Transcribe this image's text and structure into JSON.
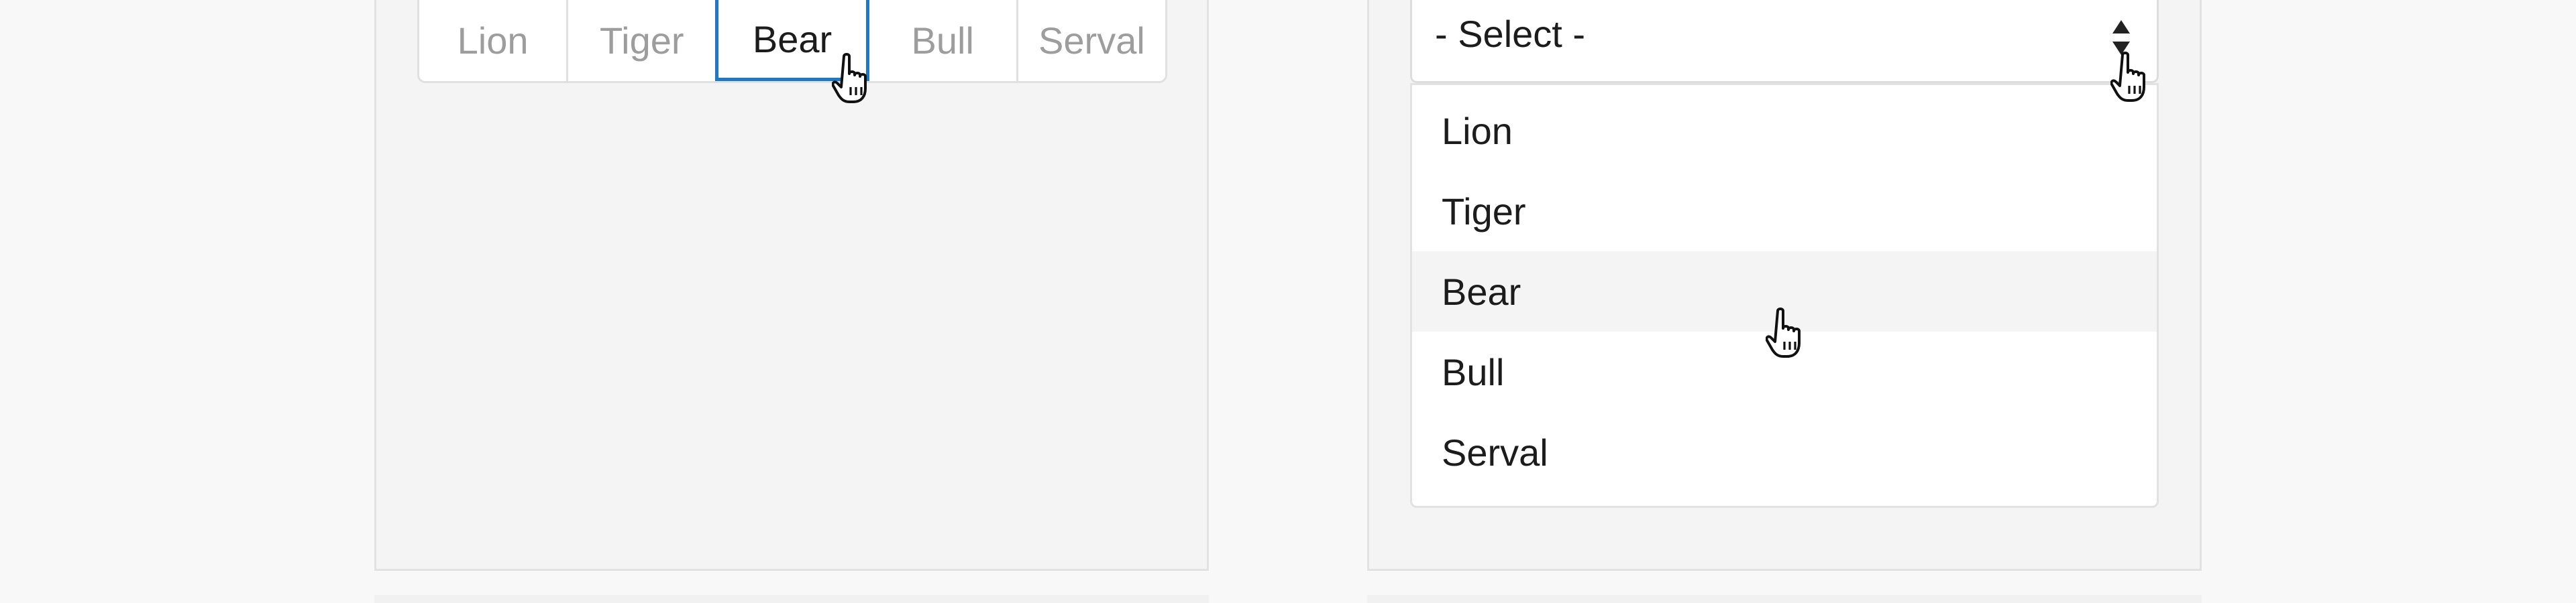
{
  "segmented_control": {
    "options": [
      "Lion",
      "Tiger",
      "Bear",
      "Bull",
      "Serval"
    ],
    "selected": "Bear",
    "accent_color": "#1f78c4"
  },
  "select": {
    "value": "- Select -",
    "arrows_icon": "sort-arrows-icon"
  },
  "dropdown": {
    "options": [
      "Lion",
      "Tiger",
      "Bear",
      "Bull",
      "Serval"
    ],
    "hovered": "Bear"
  },
  "cursors": {
    "icon": "hand-pointer-cursor"
  }
}
